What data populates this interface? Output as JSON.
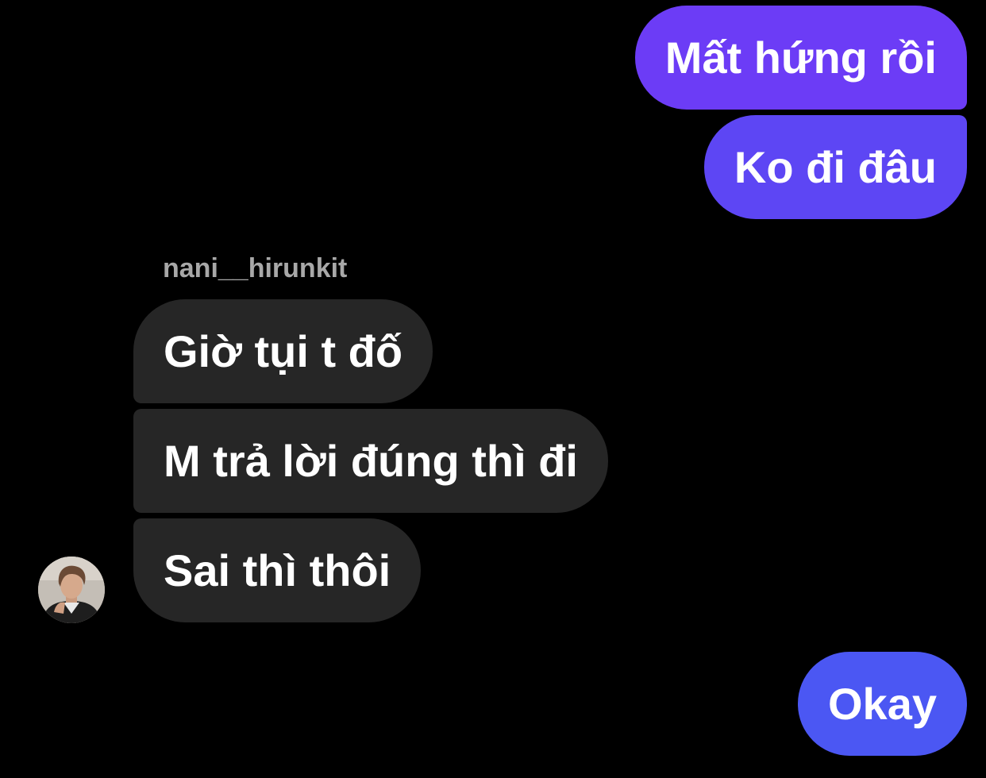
{
  "messages": {
    "outgoing": [
      {
        "text": "Mất hứng rồi"
      },
      {
        "text": "Ko đi đâu"
      },
      {
        "text": "Okay"
      }
    ],
    "incoming": {
      "sender_name": "nani__hirunkit",
      "items": [
        {
          "text": "Giờ tụi t đố"
        },
        {
          "text": "M trả lời đúng thì đi"
        },
        {
          "text": "Sai thì thôi"
        }
      ]
    }
  },
  "avatar": {
    "icon": "profile-photo-avatar"
  },
  "colors": {
    "background": "#000000",
    "outgoing_top": "#6c3cf6",
    "outgoing_mid": "#5d46f4",
    "outgoing_bottom": "#4b57f3",
    "incoming": "#262626",
    "sender_name": "#a8a8a8",
    "text": "#ffffff"
  }
}
